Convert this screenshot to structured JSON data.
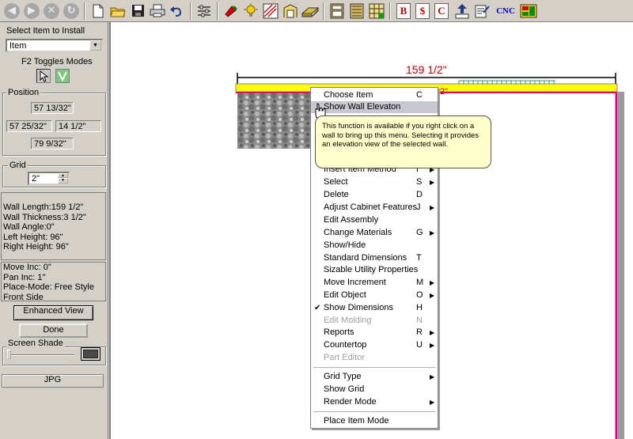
{
  "toolbar": {
    "icons": [
      "back-arrow",
      "forward-arrow",
      "stop",
      "refresh",
      "new-file",
      "open-folder",
      "save",
      "print",
      "undo",
      "settings-list",
      "paint",
      "light",
      "drawing",
      "wall",
      "floor",
      "cabinet",
      "cabinet-alt",
      "grid-sheet",
      "report-b",
      "report-dollar",
      "report-c",
      "export",
      "edit-note",
      "cnc",
      "layout"
    ],
    "cnc_label": "CNC",
    "report_b": "B",
    "report_dollar": "$",
    "report_c": "C"
  },
  "left_panel": {
    "select_label": "Select Item to Install",
    "item_combo_value": "Item",
    "modes_label": "F2 Toggles Modes",
    "position": {
      "title": "Position",
      "top": "57 13/32\"",
      "left": "57 25/32\"",
      "right": "14 1/2\"",
      "bottom": "79 9/32\""
    },
    "grid": {
      "title": "Grid",
      "value": "2\""
    },
    "wall_info": [
      "Wall Length:159 1/2\"",
      "Wall Thickness:3 1/2\"",
      "Wall Angle:0\"",
      "Left Height: 96\"",
      "Right Height: 96\""
    ],
    "move_info": [
      "Move Inc: 0\"",
      "Pan Inc: 1\"",
      "Place-Mode: Free Style",
      "Front Side"
    ],
    "enhanced_view_label": "Enhanced View",
    "done_label": "Done",
    "screen_shade_label": "Screen Shade",
    "jpg_label": "JPG"
  },
  "canvas": {
    "dimension_label": "159 1/2\"",
    "partial_label": "2\""
  },
  "context_menu": {
    "items": [
      {
        "label": "Choose Item",
        "key": "C",
        "sub": false,
        "disabled": false,
        "checked": false,
        "highlighted": false
      },
      {
        "label": "Show Wall Elevaton",
        "key": "",
        "sub": false,
        "disabled": false,
        "checked": false,
        "highlighted": true
      },
      {
        "label": "Insert Item Method",
        "key": "I",
        "sub": true,
        "disabled": false,
        "checked": false,
        "highlighted": false
      },
      {
        "label": "Select",
        "key": "S",
        "sub": true,
        "disabled": false,
        "checked": false,
        "highlighted": false
      },
      {
        "label": "Delete",
        "key": "D",
        "sub": false,
        "disabled": false,
        "checked": false,
        "highlighted": false
      },
      {
        "label": "Adjust Cabinet Features",
        "key": "J",
        "sub": true,
        "disabled": false,
        "checked": false,
        "highlighted": false
      },
      {
        "label": "Edit Assembly",
        "key": "",
        "sub": false,
        "disabled": false,
        "checked": false,
        "highlighted": false
      },
      {
        "label": "Change Materials",
        "key": "G",
        "sub": true,
        "disabled": false,
        "checked": false,
        "highlighted": false
      },
      {
        "label": "Show/Hide",
        "key": "",
        "sub": false,
        "disabled": false,
        "checked": false,
        "highlighted": false
      },
      {
        "label": "Standard Dimensions",
        "key": "T",
        "sub": false,
        "disabled": false,
        "checked": false,
        "highlighted": false
      },
      {
        "label": "Sizable Utility Properties",
        "key": "",
        "sub": false,
        "disabled": false,
        "checked": false,
        "highlighted": false
      },
      {
        "label": "Move Increment",
        "key": "M",
        "sub": true,
        "disabled": false,
        "checked": false,
        "highlighted": false
      },
      {
        "label": "Edit Object",
        "key": "O",
        "sub": true,
        "disabled": false,
        "checked": false,
        "highlighted": false
      },
      {
        "label": "Show Dimensions",
        "key": "H",
        "sub": false,
        "disabled": false,
        "checked": true,
        "highlighted": false
      },
      {
        "label": "Edit Molding",
        "key": "N",
        "sub": false,
        "disabled": true,
        "checked": false,
        "highlighted": false
      },
      {
        "label": "Reports",
        "key": "R",
        "sub": true,
        "disabled": false,
        "checked": false,
        "highlighted": false
      },
      {
        "label": "Countertop",
        "key": "U",
        "sub": true,
        "disabled": false,
        "checked": false,
        "highlighted": false
      },
      {
        "label": "Part Editor",
        "key": "",
        "sub": false,
        "disabled": true,
        "checked": false,
        "highlighted": false
      },
      {
        "label": "Grid Type",
        "key": "",
        "sub": true,
        "disabled": false,
        "checked": false,
        "highlighted": false
      },
      {
        "label": "Show Grid",
        "key": "",
        "sub": false,
        "disabled": false,
        "checked": false,
        "highlighted": false
      },
      {
        "label": "Render Mode",
        "key": "",
        "sub": true,
        "disabled": false,
        "checked": false,
        "highlighted": false
      },
      {
        "label": "Place Item Mode",
        "key": "",
        "sub": false,
        "disabled": false,
        "checked": false,
        "highlighted": false
      }
    ]
  },
  "tooltip": {
    "text": "This function is available if you right click on a wall to bring up this menu. Selecting it provides an elevation view of the selected wall."
  },
  "colors": {
    "wall_fill": "#ffff00",
    "wall_edge": "#e0007f",
    "dimension": "#cc0000",
    "tooltip_bg": "#ffffcc",
    "menu_highlight": "#c8c8d0"
  }
}
